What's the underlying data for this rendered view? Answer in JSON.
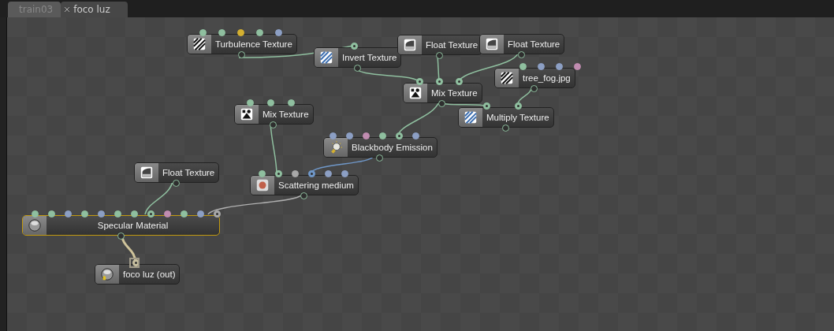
{
  "tabs": [
    {
      "label": "train03",
      "selected": false,
      "closable": false
    },
    {
      "label": "foco luz",
      "selected": true,
      "closable": true
    }
  ],
  "nodes": [
    {
      "label": "Turbulence Texture",
      "kind": "stripes",
      "selected": false,
      "pins": [
        {
          "color": "#8fbf9f",
          "connected": false
        },
        {
          "color": "#8fbf9f",
          "connected": false
        },
        {
          "color": "#d4b030",
          "connected": false
        },
        {
          "color": "#8fbf9f",
          "connected": false
        },
        {
          "color": "#8c9fc4",
          "connected": false
        }
      ]
    },
    {
      "label": "Invert Texture",
      "kind": "stripes-blue",
      "selected": false,
      "pins": [
        {
          "color": "#8fbf9f",
          "connected": true
        }
      ]
    },
    {
      "label": "Float Texture",
      "kind": "float",
      "selected": false
    },
    {
      "label": "Float Texture",
      "kind": "float",
      "selected": false
    },
    {
      "label": "tree_fog.jpg",
      "kind": "stripes",
      "selected": false,
      "pins": [
        {
          "color": "#8fbf9f",
          "connected": false
        },
        {
          "color": "#8c9fc4",
          "connected": false
        },
        {
          "color": "#8c9fc4",
          "connected": false
        },
        {
          "color": "#c08cb0",
          "connected": false
        }
      ]
    },
    {
      "label": "Mix Texture",
      "kind": "mix",
      "selected": false,
      "pins": [
        {
          "color": "#8fbf9f",
          "connected": true
        },
        {
          "color": "#8fbf9f",
          "connected": true
        },
        {
          "color": "#8fbf9f",
          "connected": true
        }
      ]
    },
    {
      "label": "Multiply Texture",
      "kind": "stripes-blue",
      "selected": false,
      "pins": [
        {
          "color": "#8fbf9f",
          "connected": true
        },
        {
          "color": "#8fbf9f",
          "connected": true
        }
      ]
    },
    {
      "label": "Mix Texture",
      "kind": "mix",
      "selected": false,
      "pins": [
        {
          "color": "#8fbf9f",
          "connected": false
        },
        {
          "color": "#8fbf9f",
          "connected": false
        },
        {
          "color": "#8fbf9f",
          "connected": false
        }
      ]
    },
    {
      "label": "Blackbody Emission",
      "kind": "emission",
      "selected": false,
      "pins": [
        {
          "color": "#8c9fc4",
          "connected": false
        },
        {
          "color": "#8c9fc4",
          "connected": false
        },
        {
          "color": "#c08cb0",
          "connected": false
        },
        {
          "color": "#8fbf9f",
          "connected": false
        },
        {
          "color": "#8fbf9f",
          "connected": true
        },
        {
          "color": "#8c9fc4",
          "connected": false
        }
      ]
    },
    {
      "label": "Float Texture",
      "kind": "float",
      "selected": false
    },
    {
      "label": "Scattering medium",
      "kind": "medium",
      "selected": false,
      "pins": [
        {
          "color": "#8fbf9f",
          "connected": false
        },
        {
          "color": "#8fbf9f",
          "connected": true
        },
        {
          "color": "#a8a8a8",
          "connected": false
        },
        {
          "color": "#6f97c8",
          "connected": true
        },
        {
          "color": "#8c9fc4",
          "connected": false
        },
        {
          "color": "#8c9fc4",
          "connected": false
        }
      ]
    },
    {
      "label": "Specular Material",
      "kind": "material",
      "selected": true,
      "pins": [
        {
          "color": "#8fbf9f",
          "connected": false
        },
        {
          "color": "#8fbf9f",
          "connected": false
        },
        {
          "color": "#8c9fc4",
          "connected": false
        },
        {
          "color": "#8fbf9f",
          "connected": false
        },
        {
          "color": "#8c9fc4",
          "connected": false
        },
        {
          "color": "#8fbf9f",
          "connected": false
        },
        {
          "color": "#8fbf9f",
          "connected": false
        },
        {
          "color": "#8fbf9f",
          "connected": true
        },
        {
          "color": "#c08cb0",
          "connected": false
        },
        {
          "color": "#8fbf9f",
          "connected": false
        },
        {
          "color": "#8c9fc4",
          "connected": false
        },
        {
          "color": "#a8a8a8",
          "connected": true
        }
      ]
    },
    {
      "label": "foco luz (out)",
      "kind": "output",
      "selected": false,
      "pins": [
        {
          "color": "#c8c0a0",
          "connected": true
        }
      ]
    }
  ]
}
